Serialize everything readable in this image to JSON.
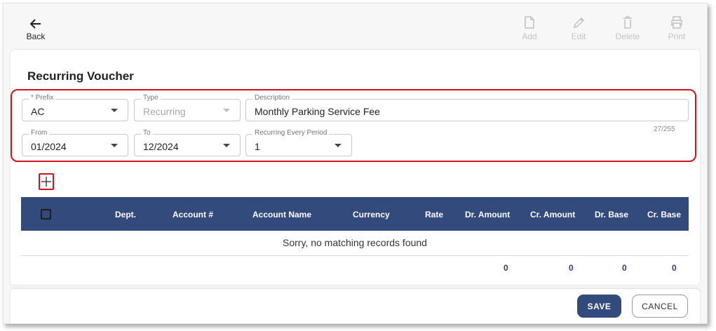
{
  "toolbar": {
    "back_label": "Back",
    "back_icon": "arrow-left-icon",
    "add_label": "Add",
    "edit_label": "Edit",
    "delete_label": "Delete",
    "print_label": "Print"
  },
  "page_title": "Recurring Voucher",
  "form": {
    "prefix": {
      "label": "* Prefix",
      "value": "AC"
    },
    "type": {
      "label": "Type",
      "value": "Recurring"
    },
    "description": {
      "label": "Description",
      "value": "Monthly Parking Service Fee",
      "counter": "27/255"
    },
    "from": {
      "label": "From",
      "value": "01/2024"
    },
    "to": {
      "label": "To",
      "value": "12/2024"
    },
    "recurring_period": {
      "label": "Recurring Every Period",
      "value": "1"
    }
  },
  "table": {
    "columns": [
      "Dept.",
      "Account #",
      "Account Name",
      "Currency",
      "Rate",
      "Dr. Amount",
      "Cr. Amount",
      "Dr. Base",
      "Cr. Base"
    ],
    "empty_message": "Sorry, no matching records found",
    "totals": {
      "dr_amount": "0",
      "cr_amount": "0",
      "dr_base": "0",
      "cr_base": "0"
    }
  },
  "footer": {
    "save_label": "SAVE",
    "cancel_label": "CANCEL"
  },
  "colors": {
    "header_bg": "#324a7c",
    "highlight": "#d0141c",
    "disabled": "#c4c4c4"
  }
}
